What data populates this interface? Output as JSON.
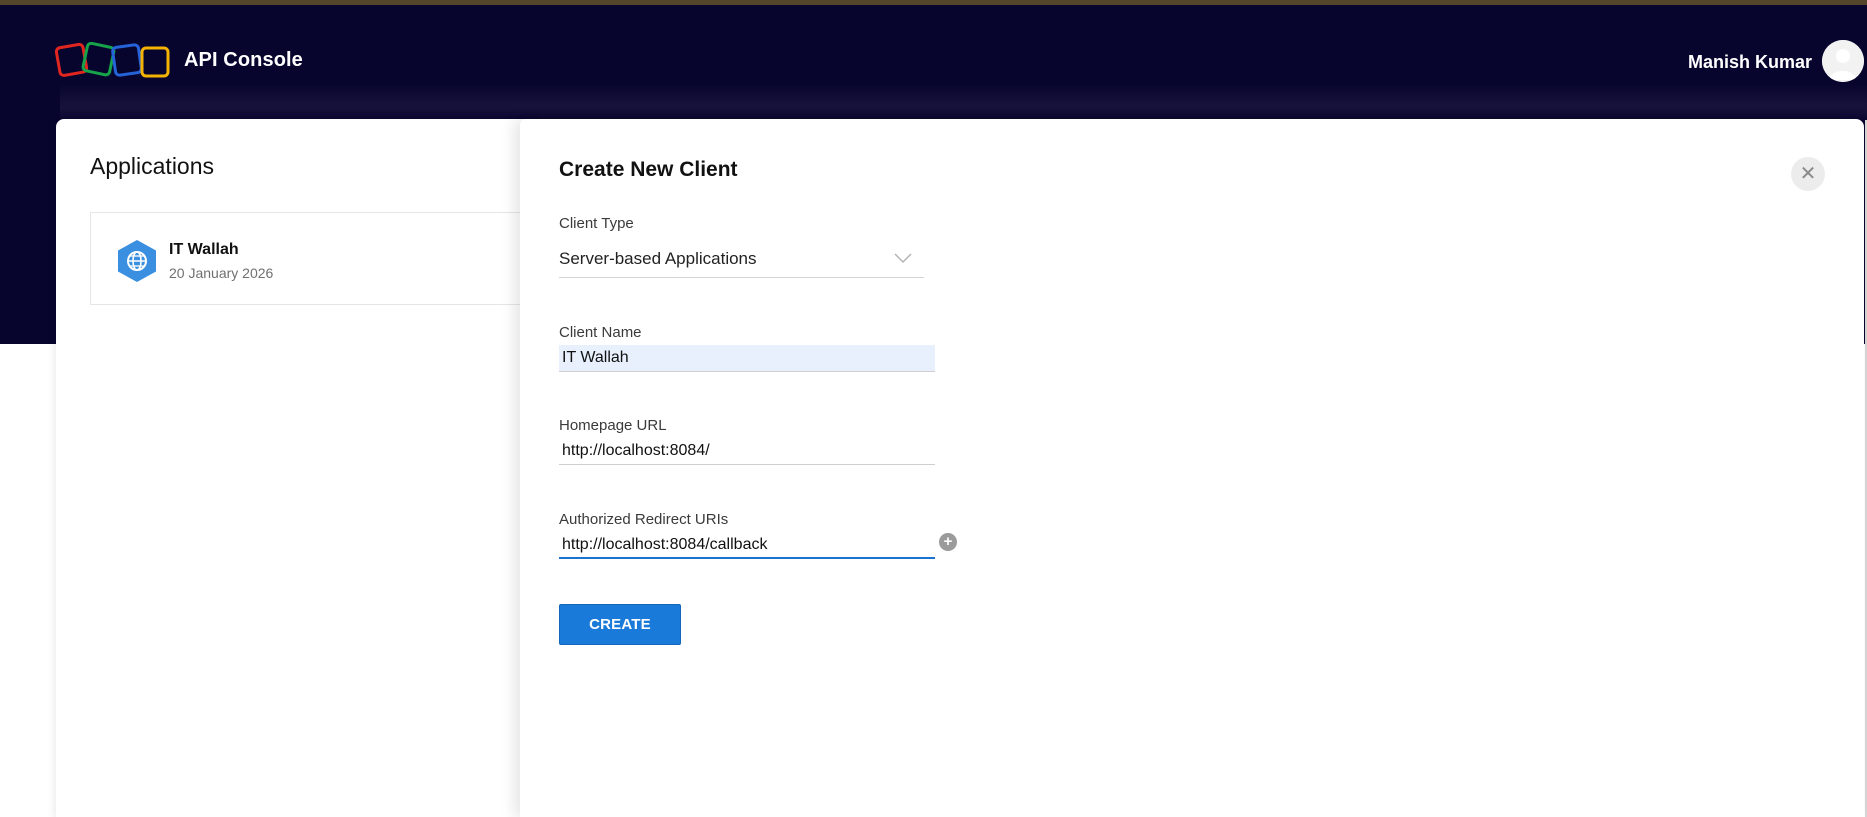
{
  "header": {
    "brand": "API Console",
    "user_name": "Manish Kumar",
    "colors": {
      "background": "#07042e",
      "logo": [
        "#e0261f",
        "#16a34a",
        "#2563d9",
        "#f5b301"
      ]
    }
  },
  "applications": {
    "title": "Applications",
    "items": [
      {
        "name": "IT Wallah",
        "date": "20 January 2026",
        "icon": "globe-icon"
      }
    ]
  },
  "create_client": {
    "title": "Create New Client",
    "close_icon": "close-icon",
    "client_type": {
      "label": "Client Type",
      "value": "Server-based Applications"
    },
    "client_name": {
      "label": "Client Name",
      "value": "IT Wallah"
    },
    "homepage_url": {
      "label": "Homepage URL",
      "value": "http://localhost:8084/"
    },
    "redirect_uris": {
      "label": "Authorized Redirect URIs",
      "value": "http://localhost:8084/callback",
      "add_icon": "plus-circle-icon"
    },
    "submit_label": "CREATE",
    "accent": "#1a7ad9"
  }
}
